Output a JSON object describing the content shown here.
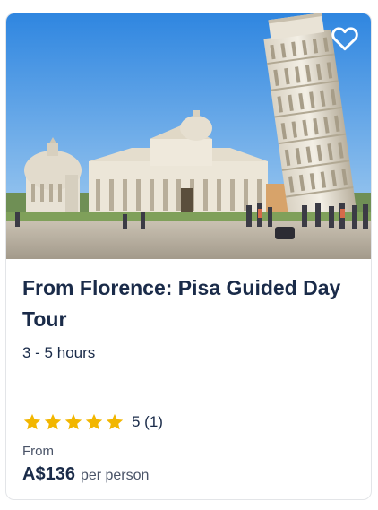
{
  "card": {
    "title": "From Florence: Pisa Guided Day Tour",
    "duration": "3 - 5 hours",
    "rating": {
      "stars": 5,
      "score_text": "5 (1)",
      "star_color": "#f2b600"
    },
    "price": {
      "from_label": "From",
      "amount": "A$136",
      "unit": "per person"
    },
    "favorite_icon": "heart-outline-icon",
    "image_subject": "tower-cathedral-photo"
  },
  "colors": {
    "title": "#1a2b49",
    "secondary": "#4a5468",
    "border": "#e3e5e8"
  }
}
